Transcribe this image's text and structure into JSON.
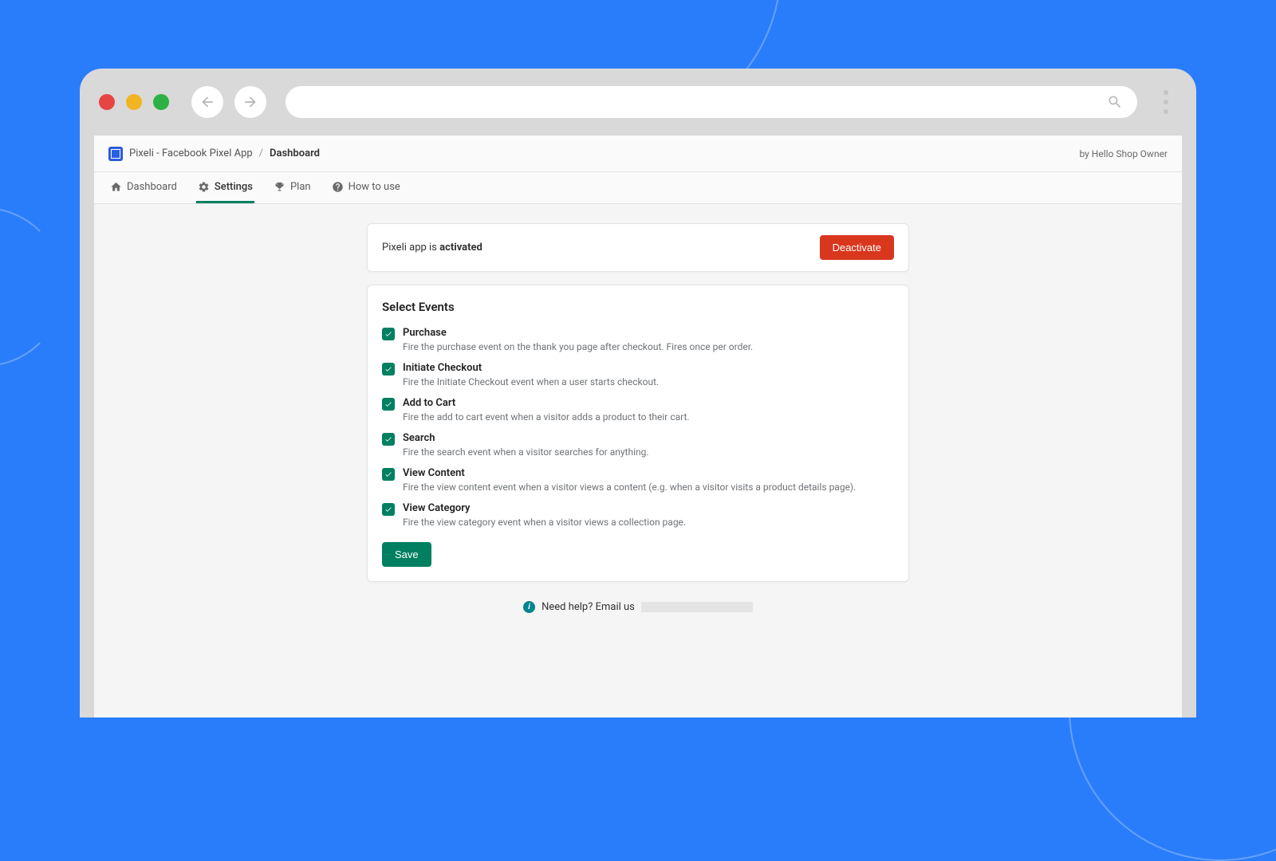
{
  "breadcrumb": {
    "app_name": "Pixeli - Facebook Pixel App",
    "separator": "/",
    "current": "Dashboard"
  },
  "attribution": "by Hello Shop Owner",
  "tabs": [
    {
      "label": "Dashboard",
      "icon": "home"
    },
    {
      "label": "Settings",
      "icon": "gear",
      "active": true
    },
    {
      "label": "Plan",
      "icon": "trophy"
    },
    {
      "label": "How to use",
      "icon": "question"
    }
  ],
  "status": {
    "prefix": "Pixeli app is ",
    "state": "activated",
    "button": "Deactivate"
  },
  "events_card": {
    "title": "Select Events",
    "save_label": "Save",
    "events": [
      {
        "checked": true,
        "label": "Purchase",
        "desc": "Fire the purchase event on the thank you page after checkout. Fires once per order."
      },
      {
        "checked": true,
        "label": "Initiate Checkout",
        "desc": "Fire the Initiate Checkout event when a user starts checkout."
      },
      {
        "checked": true,
        "label": "Add to Cart",
        "desc": "Fire the add to cart event when a visitor adds a product to their cart."
      },
      {
        "checked": true,
        "label": "Search",
        "desc": "Fire the search event when a visitor searches for anything."
      },
      {
        "checked": true,
        "label": "View Content",
        "desc": "Fire the view content event when a visitor views a content (e.g. when a visitor visits a product details page)."
      },
      {
        "checked": true,
        "label": "View Category",
        "desc": "Fire the view category event when a visitor views a collection page."
      }
    ]
  },
  "help": {
    "text": "Need help? Email us"
  }
}
